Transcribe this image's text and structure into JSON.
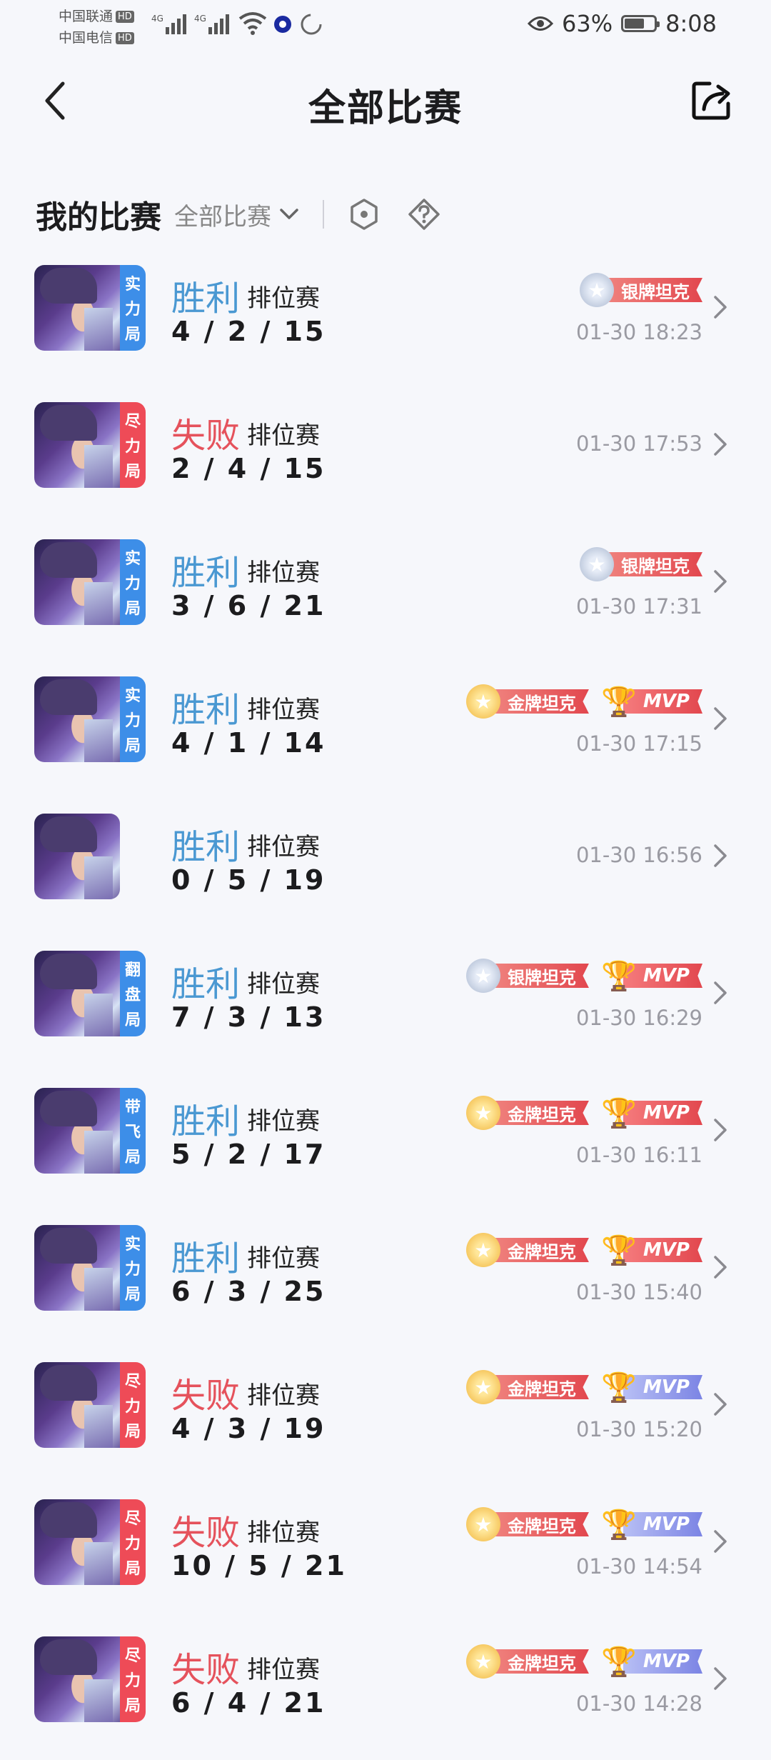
{
  "status_bar": {
    "carrier1": "中国联通",
    "carrier2": "中国电信",
    "hd": "HD",
    "net1": "4G",
    "net2": "4G",
    "battery_pct": "63%",
    "time": "8:08"
  },
  "header": {
    "title": "全部比赛"
  },
  "filter": {
    "section_title": "我的比赛",
    "select_value": "全部比赛"
  },
  "colors": {
    "win": "#4a98d2",
    "lose": "#e5525c",
    "tag_blue": "#3d8ee8",
    "tag_red": "#ee4b57"
  },
  "matches": [
    {
      "tag": [
        "实",
        "力",
        "局"
      ],
      "tag_color": "blue",
      "result": "胜利",
      "outcome": "win",
      "mode": "排位赛",
      "kda": "4 / 2 / 15",
      "time": "01-30 18:23",
      "badges": [
        {
          "type": "silver",
          "label": "银牌坦克"
        }
      ]
    },
    {
      "tag": [
        "尽",
        "力",
        "局"
      ],
      "tag_color": "red",
      "result": "失败",
      "outcome": "lose",
      "mode": "排位赛",
      "kda": "2 / 4 / 15",
      "time": "01-30 17:53",
      "badges": []
    },
    {
      "tag": [
        "实",
        "力",
        "局"
      ],
      "tag_color": "blue",
      "result": "胜利",
      "outcome": "win",
      "mode": "排位赛",
      "kda": "3 / 6 / 21",
      "time": "01-30 17:31",
      "badges": [
        {
          "type": "silver",
          "label": "银牌坦克"
        }
      ]
    },
    {
      "tag": [
        "实",
        "力",
        "局"
      ],
      "tag_color": "blue",
      "result": "胜利",
      "outcome": "win",
      "mode": "排位赛",
      "kda": "4 / 1 / 14",
      "time": "01-30 17:15",
      "badges": [
        {
          "type": "gold",
          "label": "金牌坦克"
        },
        {
          "type": "mvp",
          "label": "MVP"
        }
      ]
    },
    {
      "tag": [],
      "tag_color": "",
      "result": "胜利",
      "outcome": "win",
      "mode": "排位赛",
      "kda": "0 / 5 / 19",
      "time": "01-30 16:56",
      "badges": []
    },
    {
      "tag": [
        "翻",
        "盘",
        "局"
      ],
      "tag_color": "blue",
      "result": "胜利",
      "outcome": "win",
      "mode": "排位赛",
      "kda": "7 / 3 / 13",
      "time": "01-30 16:29",
      "badges": [
        {
          "type": "silver",
          "label": "银牌坦克"
        },
        {
          "type": "mvp",
          "label": "MVP"
        }
      ]
    },
    {
      "tag": [
        "带",
        "飞",
        "局"
      ],
      "tag_color": "blue",
      "result": "胜利",
      "outcome": "win",
      "mode": "排位赛",
      "kda": "5 / 2 / 17",
      "time": "01-30 16:11",
      "badges": [
        {
          "type": "gold",
          "label": "金牌坦克"
        },
        {
          "type": "mvp",
          "label": "MVP"
        }
      ]
    },
    {
      "tag": [
        "实",
        "力",
        "局"
      ],
      "tag_color": "blue",
      "result": "胜利",
      "outcome": "win",
      "mode": "排位赛",
      "kda": "6 / 3 / 25",
      "time": "01-30 15:40",
      "badges": [
        {
          "type": "gold",
          "label": "金牌坦克"
        },
        {
          "type": "mvp",
          "label": "MVP"
        }
      ]
    },
    {
      "tag": [
        "尽",
        "力",
        "局"
      ],
      "tag_color": "red",
      "result": "失败",
      "outcome": "lose",
      "mode": "排位赛",
      "kda": "4 / 3 / 19",
      "time": "01-30 15:20",
      "badges": [
        {
          "type": "gold",
          "label": "金牌坦克"
        },
        {
          "type": "mvp-blue",
          "label": "MVP"
        }
      ]
    },
    {
      "tag": [
        "尽",
        "力",
        "局"
      ],
      "tag_color": "red",
      "result": "失败",
      "outcome": "lose",
      "mode": "排位赛",
      "kda": "10 / 5 / 21",
      "time": "01-30 14:54",
      "badges": [
        {
          "type": "gold",
          "label": "金牌坦克"
        },
        {
          "type": "mvp-blue",
          "label": "MVP"
        }
      ]
    },
    {
      "tag": [
        "尽",
        "力",
        "局"
      ],
      "tag_color": "red",
      "result": "失败",
      "outcome": "lose",
      "mode": "排位赛",
      "kda": "6 / 4 / 21",
      "time": "01-30 14:28",
      "badges": [
        {
          "type": "gold",
          "label": "金牌坦克"
        },
        {
          "type": "mvp-blue",
          "label": "MVP"
        }
      ]
    }
  ]
}
